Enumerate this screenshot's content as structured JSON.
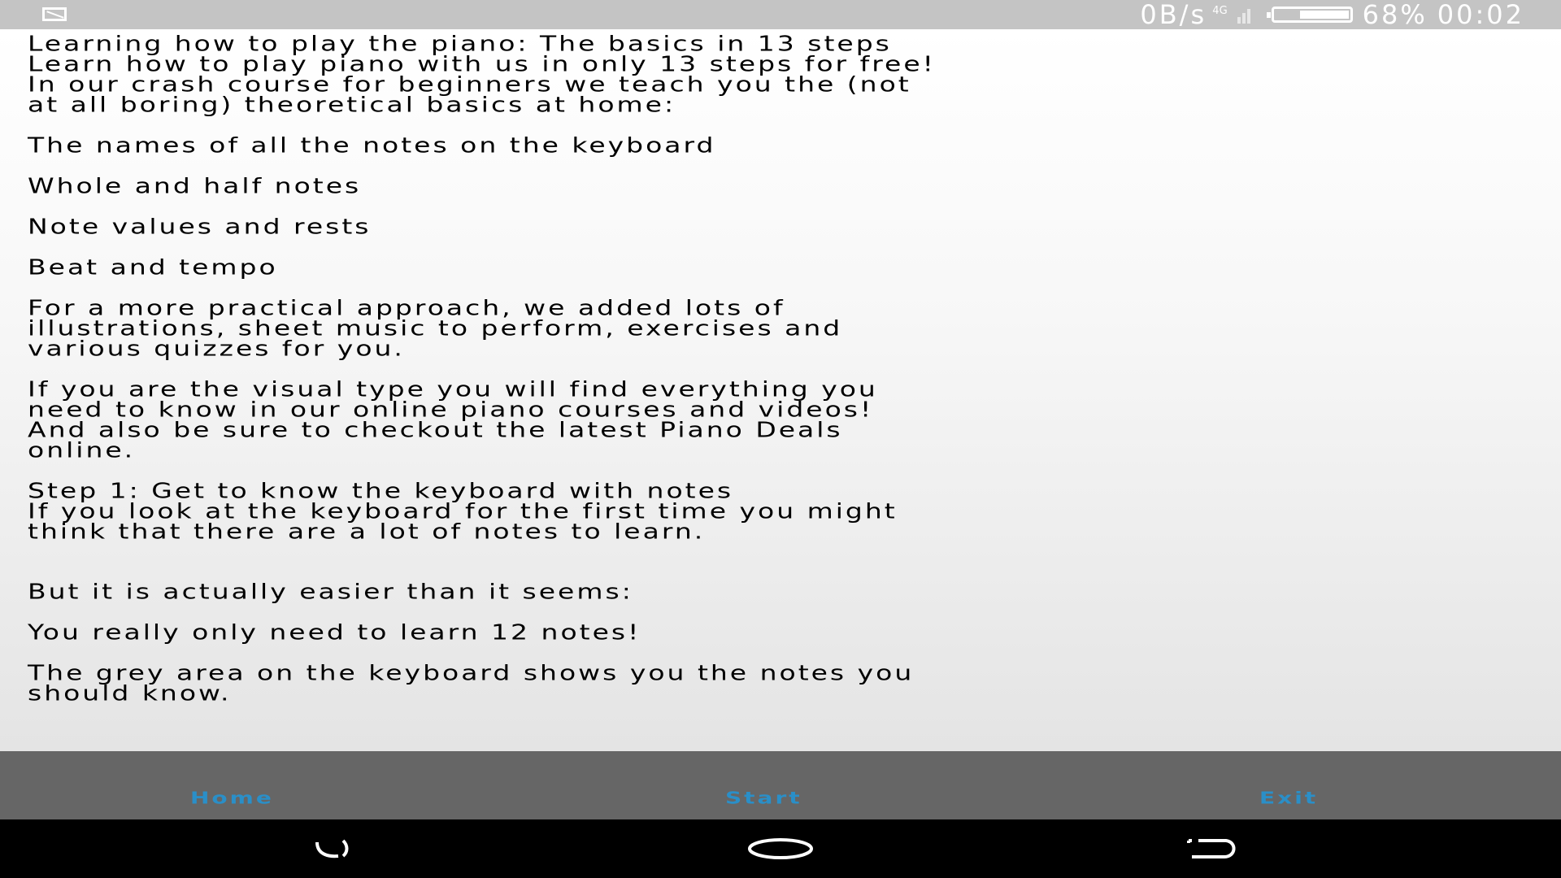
{
  "status_bar": {
    "net_speed": "0B/s",
    "net_type": "4G",
    "battery": "68%",
    "time": "00:02",
    "battery_level": 0.68
  },
  "article": {
    "paragraphs": [
      "Learning how to play the piano: The basics in 13 steps",
      "Learn how to play piano with us in only 13 steps for free!",
      "In our crash course for beginners we teach you the (not",
      "at all boring) theoretical basics at home:",
      "The names of all the notes on the keyboard",
      "Whole and half notes",
      "Note values and rests",
      "Beat and tempo",
      "For a more practical approach, we added lots of",
      "illustrations, sheet music to perform, exercises and",
      "various quizzes for you.",
      "If you are the visual type you will find everything you",
      "need to know in our online piano courses and videos!",
      "And also be sure to checkout the latest Piano Deals",
      "online.",
      "Step 1: Get to know the keyboard with notes",
      "If you look at the keyboard for the first time you might",
      "think that there are a lot of notes to learn.",
      "But it is actually easier than it seems:",
      "You really only need to learn 12 notes!",
      "The grey area on the keyboard shows you the notes you",
      "should know."
    ]
  },
  "bottom_nav": {
    "home": "Home",
    "start": "Start",
    "exit": "Exit"
  },
  "colors": {
    "nav_text": "#2a8fc8",
    "bottom_bar": "#666666",
    "status_bar": "#c4c4c4"
  },
  "icons": {
    "status_left": "screenshot-icon",
    "signal": "signal-icon",
    "battery": "battery-icon",
    "recent": "recent-apps-icon",
    "home": "home-circle-icon",
    "back": "back-icon"
  }
}
